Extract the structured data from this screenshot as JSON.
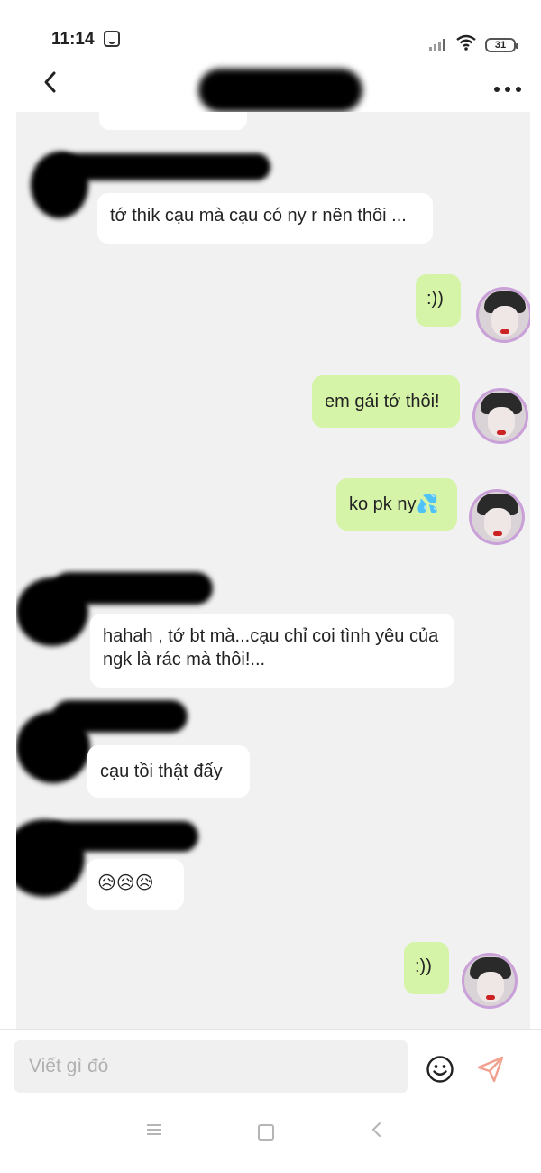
{
  "status_bar": {
    "time": "11:14",
    "battery": "31"
  },
  "header": {
    "contact_name": ""
  },
  "messages": [
    {
      "side": "in",
      "text": "tớ thik cạu mà cạu có ny r nên thôi ..."
    },
    {
      "side": "out",
      "text": ":))"
    },
    {
      "side": "out",
      "text": "em gái tớ thôi!"
    },
    {
      "side": "out",
      "text": "ko pk ny💦"
    },
    {
      "side": "in",
      "text": "hahah , tớ bt mà...cạu chỉ coi tình yêu của ngk là rác mà thôi!..."
    },
    {
      "side": "in",
      "text": "cạu tồi thật đấy"
    },
    {
      "side": "in",
      "text": "😥😥😥"
    },
    {
      "side": "out",
      "text": ":))"
    }
  ],
  "composer": {
    "placeholder": "Viết gì đó"
  },
  "colors": {
    "outgoing_bubble": "#d6f4a8",
    "incoming_bubble": "#ffffff",
    "chat_background": "#f1f1f1",
    "send_icon": "#f2a08e"
  },
  "icons": [
    "back-icon",
    "more-icon",
    "emoji-icon",
    "send-icon",
    "nav-menu-icon",
    "nav-home-icon",
    "nav-back-icon"
  ]
}
